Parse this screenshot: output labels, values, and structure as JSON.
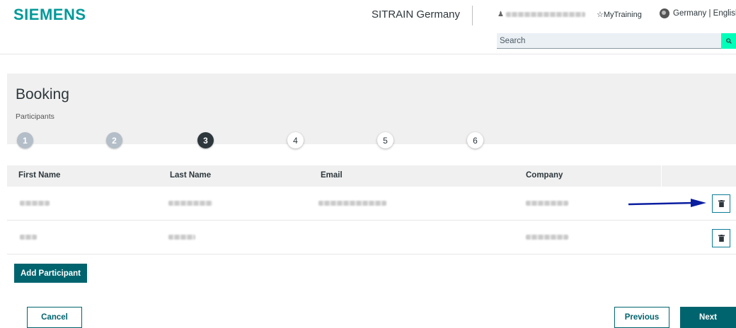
{
  "header": {
    "logo": "SIEMENS",
    "site_name": "SITRAIN Germany",
    "my_training": "☆MyTraining",
    "language": "Germany | English",
    "search_placeholder": "Search"
  },
  "booking": {
    "title": "Booking",
    "subtitle": "Participants",
    "steps": [
      "1",
      "2",
      "3",
      "4",
      "5",
      "6"
    ],
    "active_step": "3"
  },
  "table": {
    "columns": [
      "First Name",
      "Last Name",
      "Email",
      "Company"
    ]
  },
  "actions": {
    "add_participant": "Add Participant",
    "cancel": "Cancel",
    "previous": "Previous",
    "next": "Next"
  },
  "colors": {
    "brand": "#009999",
    "accent": "#00ffb9",
    "primary_button": "#00646e",
    "annotation_arrow": "#0a1ea0"
  }
}
